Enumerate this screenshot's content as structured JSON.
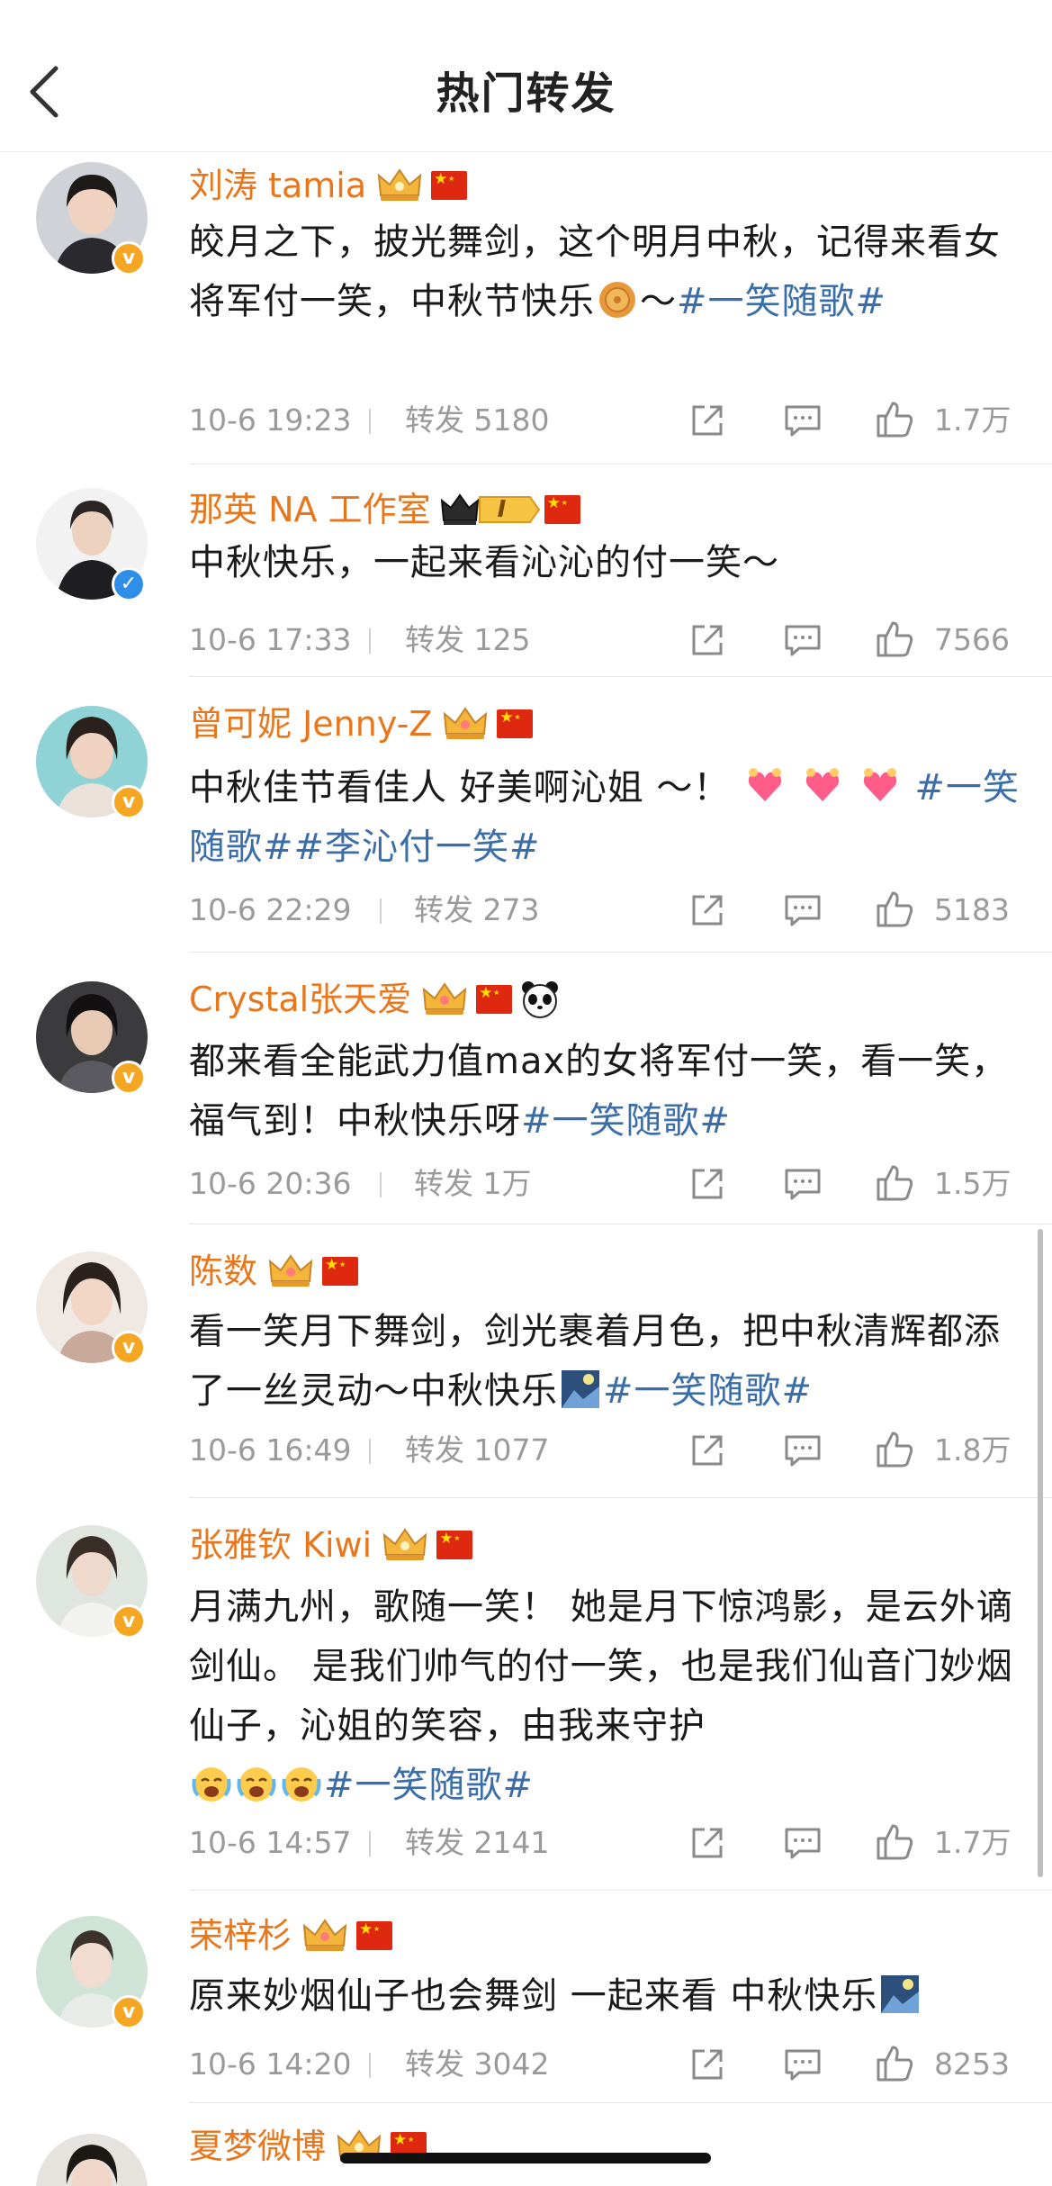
{
  "header": {
    "title": "热门转发"
  },
  "posts": [
    {
      "name": "刘涛 tamia",
      "text_before": "皎月之下，披光舞剑，这个明月中秋，记得来看女将军付一笑，中秋节快乐",
      "text_after": "～",
      "tags": "#一笑随歌#",
      "time": "10-6 19:23",
      "repost": "转发 5180",
      "likes": "1.7万"
    },
    {
      "name": "那英 NA 工作室",
      "level_badge": "I",
      "text_before": "中秋快乐，一起来看沁沁的付一笑～",
      "time": "10-6 17:33",
      "repost": "转发 125",
      "likes": "7566"
    },
    {
      "name": "曾可妮 Jenny-Z",
      "text_before": "中秋佳节看佳人 好美啊沁姐 ～！",
      "tags": "#一笑随歌##李沁付一笑#",
      "time": "10-6 22:29",
      "repost": "转发 273",
      "likes": "5183"
    },
    {
      "name": "Crystal张天爱",
      "text_before": "都来看全能武力值max的女将军付一笑，看一笑，福气到！中秋快乐呀",
      "tags": "#一笑随歌#",
      "time": "10-6 20:36",
      "repost": "转发 1万",
      "likes": "1.5万"
    },
    {
      "name": "陈数",
      "text_before": "看一笑月下舞剑，剑光裹着月色，把中秋清辉都添了一丝灵动～中秋快乐",
      "tags": "#一笑随歌#",
      "time": "10-6 16:49",
      "repost": "转发 1077",
      "likes": "1.8万"
    },
    {
      "name": "张雅钦 Kiwi",
      "text_before": "月满九州，歌随一笑！ 她是月下惊鸿影，是云外谪剑仙。 是我们帅气的付一笑，也是我们仙音门妙烟仙子，沁姐的笑容，由我来守护",
      "tags": "#一笑随歌#",
      "time": "10-6 14:57",
      "repost": "转发 2141",
      "likes": "1.7万"
    },
    {
      "name": "荣梓杉",
      "text_before": "原来妙烟仙子也会舞剑 一起来看 中秋快乐",
      "time": "10-6 14:20",
      "repost": "转发 3042",
      "likes": "8253"
    },
    {
      "name": "夏梦微博"
    }
  ],
  "colors": {
    "name": "#e8761c",
    "tag": "#3b6ea8",
    "meta": "#9a9a9a",
    "verify_orange": "#f5a623",
    "verify_blue": "#2f8ee8"
  },
  "icons": [
    "back-arrow-icon",
    "crown-icon",
    "china-flag-icon",
    "panda-icon",
    "mooncake-icon",
    "heart-hands-icon",
    "crying-face-icon",
    "night-scene-icon",
    "share-icon",
    "comment-icon",
    "like-icon",
    "verified-icon"
  ]
}
